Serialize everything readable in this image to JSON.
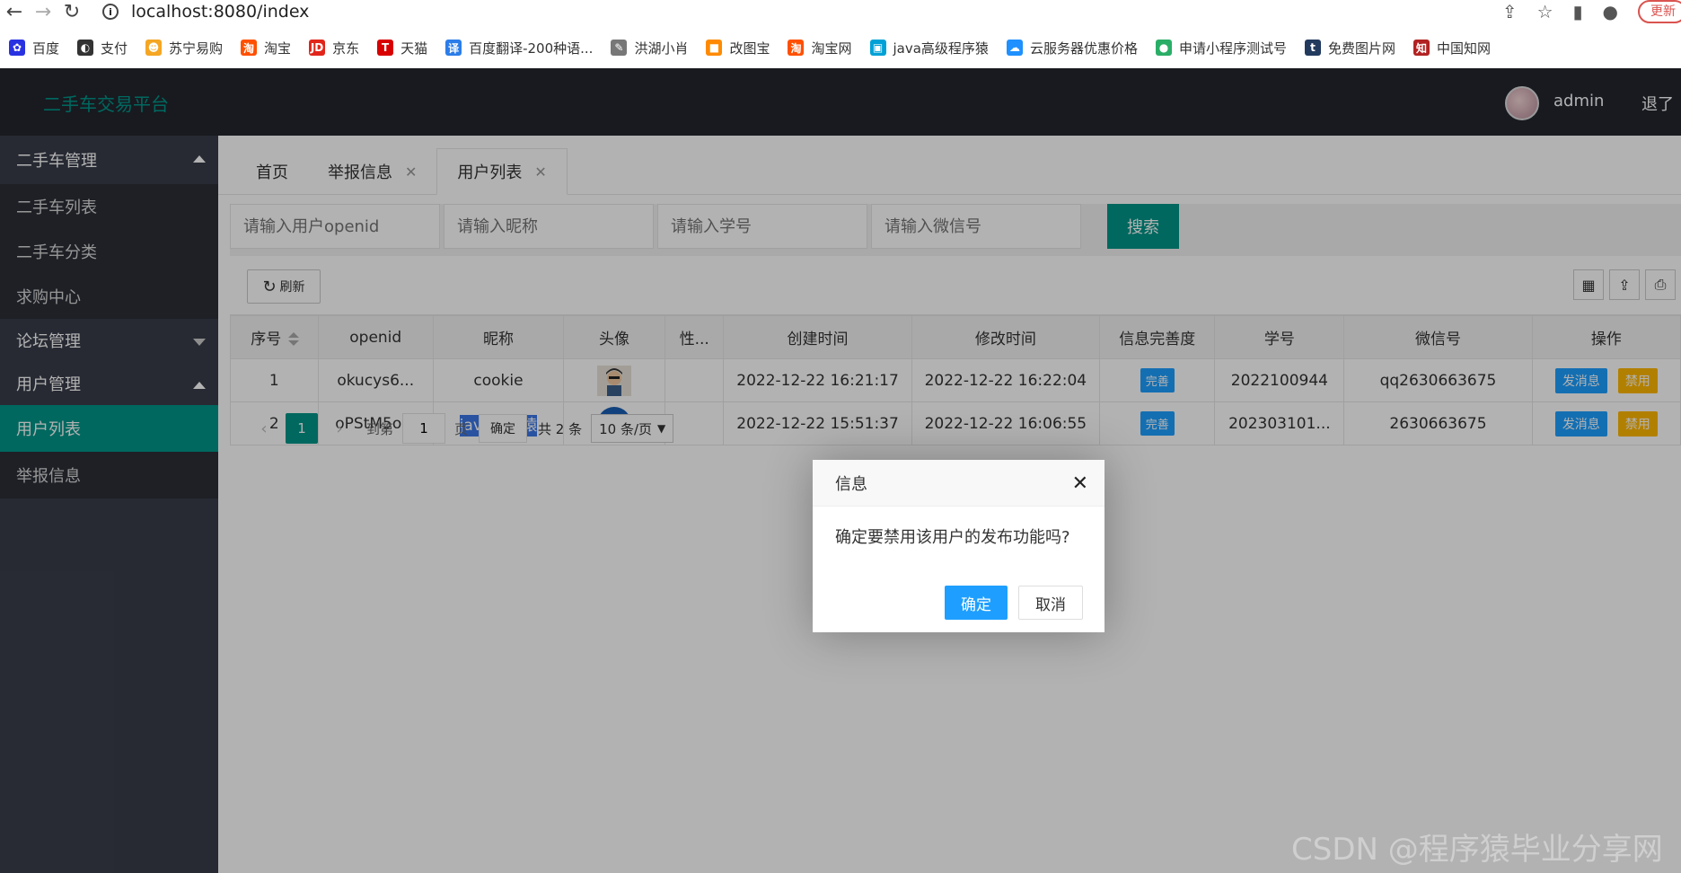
{
  "browser": {
    "url": "localhost:8080/index",
    "update_label": "更新",
    "bookmarks": [
      {
        "label": "百度",
        "color": "#2932e1"
      },
      {
        "label": "支付",
        "color": "#333333"
      },
      {
        "label": "苏宁易购",
        "color": "#f5a623"
      },
      {
        "label": "淘宝",
        "color": "#ff5000"
      },
      {
        "label": "京东",
        "color": "#e1251b"
      },
      {
        "label": "天猫",
        "color": "#d80000"
      },
      {
        "label": "百度翻译-200种语...",
        "color": "#2b7de9"
      },
      {
        "label": "洪湖小肖",
        "color": "#777777"
      },
      {
        "label": "改图宝",
        "color": "#ff8a00"
      },
      {
        "label": "淘宝网",
        "color": "#ff5000"
      },
      {
        "label": "java高级程序猿",
        "color": "#00a1d6"
      },
      {
        "label": "云服务器优惠价格",
        "color": "#1e90ff"
      },
      {
        "label": "申请小程序测试号",
        "color": "#2aae67"
      },
      {
        "label": "免费图片网",
        "color": "#223a5e"
      },
      {
        "label": "中国知网",
        "color": "#b22222"
      }
    ]
  },
  "header": {
    "title": "二手车交易平台",
    "user": "admin",
    "logout": "退了"
  },
  "sidebar": {
    "groups": [
      {
        "label": "二手车管理",
        "items": [
          "二手车列表",
          "二手车分类",
          "求购中心"
        ]
      },
      {
        "label": "论坛管理",
        "items": []
      },
      {
        "label": "用户管理",
        "items": [
          "用户列表",
          "举报信息"
        ]
      }
    ]
  },
  "tabs": [
    {
      "label": "首页"
    },
    {
      "label": "举报信息"
    },
    {
      "label": "用户列表"
    }
  ],
  "search": {
    "openid_placeholder": "请输入用户openid",
    "nickname_placeholder": "请输入昵称",
    "student_placeholder": "请输入学号",
    "wechat_placeholder": "请输入微信号",
    "button": "搜索"
  },
  "toolbar": {
    "refresh": "刷新"
  },
  "table": {
    "columns": [
      "序号",
      "openid",
      "昵称",
      "头像",
      "性...",
      "创建时间",
      "修改时间",
      "信息完善度",
      "学号",
      "微信号",
      "操作"
    ],
    "rows": [
      {
        "index": "1",
        "openid": "okucys6...",
        "nickname": "cookie",
        "gender": "",
        "created": "2022-12-22 16:21:17",
        "modified": "2022-12-22 16:22:04",
        "complete": "完善",
        "student_no": "2022100944",
        "wechat": "qq2630663675",
        "msg_btn": "发消息",
        "ban_btn": "禁用"
      },
      {
        "index": "2",
        "openid": "oPStM5o...",
        "nickname": "java程序猿",
        "gender": "",
        "created": "2022-12-22 15:51:37",
        "modified": "2022-12-22 16:06:55",
        "complete": "完善",
        "student_no": "202303101...",
        "wechat": "2630663675",
        "msg_btn": "发消息",
        "ban_btn": "禁用"
      }
    ]
  },
  "pager": {
    "current": "1",
    "goto_label": "到第",
    "goto_value": "1",
    "page_unit": "页",
    "confirm": "确定",
    "total": "共 2 条",
    "page_size": "10 条/页"
  },
  "dialog": {
    "title": "信息",
    "message": "确定要禁用该用户的发布功能吗?",
    "confirm": "确定",
    "cancel": "取消"
  },
  "watermark": "CSDN @程序猿毕业分享网",
  "colors": {
    "primary": "#009688",
    "header_bg": "#23262e",
    "sidebar_bg": "#393d49",
    "blue": "#1e9fff",
    "orange": "#ffb800"
  }
}
